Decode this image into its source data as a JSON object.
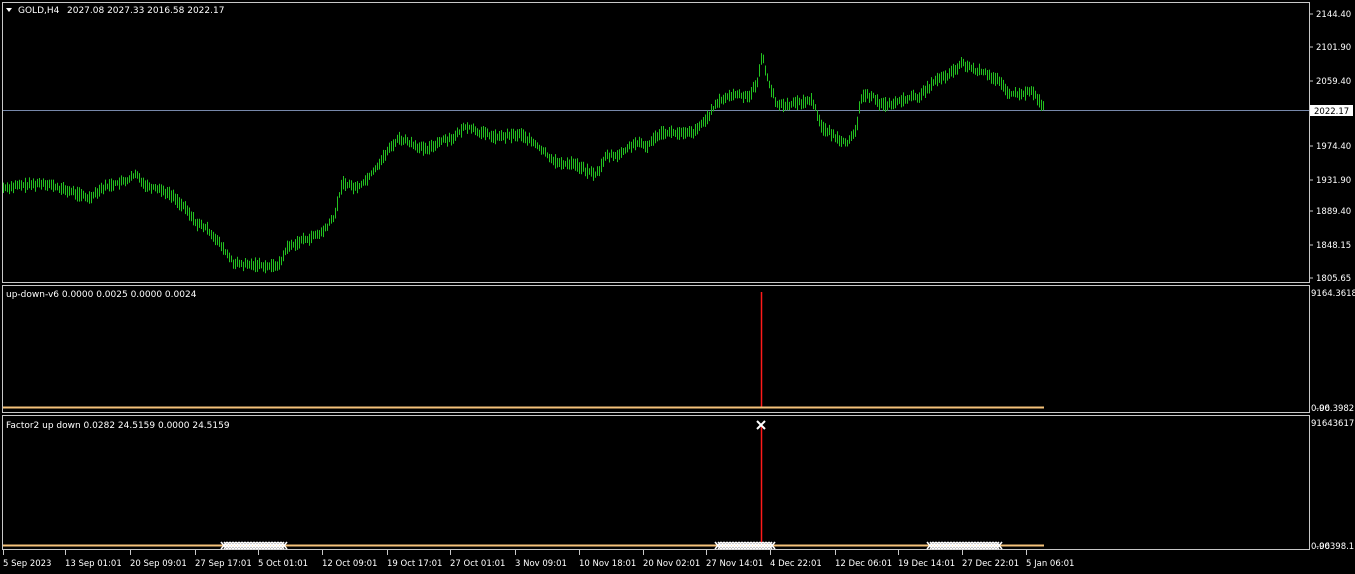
{
  "main": {
    "header_symbol": "GOLD,H4",
    "header_values": "2027.08 2027.33 2016.58 2022.17",
    "current_price_label": "2022.17",
    "current_price": 2022.17,
    "y_ticks": [
      "2144.40",
      "2101.90",
      "2059.40",
      "2022.17",
      "1974.40",
      "1931.90",
      "1889.40",
      "1848.15",
      "1805.65"
    ],
    "ylim": [
      1805.65,
      2144.4
    ],
    "bar_color": "#22c21f",
    "price_line_color": "#7788aa"
  },
  "pane1": {
    "title": "up-down-v6 0.0000 0.0025 0.0000 0.0024",
    "y_ticks": [
      "9164.3618",
      "0.00",
      "-96.3982"
    ],
    "spike_color": "#ff1a1a",
    "baseline_color": "#f5c27a"
  },
  "pane2": {
    "title": "Factor2 up down 0.0282 24.5159 0.0000 24.5159",
    "y_ticks": [
      "91643617.",
      "0.00",
      "-96398.1"
    ],
    "spike_color": "#ff1a1a",
    "baseline_color": "#f5c27a",
    "marker_color": "#ffffff"
  },
  "x_ticks": [
    "5 Sep 2023",
    "13 Sep 01:01",
    "20 Sep 09:01",
    "27 Sep 17:01",
    "5 Oct 01:01",
    "12 Oct 09:01",
    "19 Oct 17:01",
    "27 Oct 01:01",
    "3 Nov 09:01",
    "10 Nov 18:01",
    "20 Nov 02:01",
    "27 Nov 14:01",
    "4 Dec 22:01",
    "12 Dec 06:01",
    "19 Dec 14:01",
    "27 Dec 22:01",
    "5 Jan 06:01"
  ],
  "chart_data": {
    "type": "ohlc",
    "price_anchors": [
      [
        0,
        1925
      ],
      [
        20,
        1928
      ],
      [
        30,
        1929
      ],
      [
        44,
        1932
      ],
      [
        60,
        1924
      ],
      [
        72,
        1920
      ],
      [
        88,
        1912
      ],
      [
        100,
        1924
      ],
      [
        112,
        1930
      ],
      [
        124,
        1933
      ],
      [
        136,
        1942
      ],
      [
        146,
        1928
      ],
      [
        158,
        1925
      ],
      [
        172,
        1915
      ],
      [
        184,
        1900
      ],
      [
        196,
        1880
      ],
      [
        206,
        1873
      ],
      [
        214,
        1863
      ],
      [
        222,
        1848
      ],
      [
        234,
        1828
      ],
      [
        246,
        1826
      ],
      [
        258,
        1827
      ],
      [
        270,
        1824
      ],
      [
        280,
        1828
      ],
      [
        286,
        1848
      ],
      [
        300,
        1857
      ],
      [
        312,
        1862
      ],
      [
        322,
        1868
      ],
      [
        334,
        1888
      ],
      [
        342,
        1932
      ],
      [
        356,
        1925
      ],
      [
        366,
        1936
      ],
      [
        376,
        1952
      ],
      [
        386,
        1970
      ],
      [
        398,
        1989
      ],
      [
        412,
        1982
      ],
      [
        426,
        1973
      ],
      [
        440,
        1986
      ],
      [
        454,
        1990
      ],
      [
        466,
        2005
      ],
      [
        480,
        1996
      ],
      [
        496,
        1990
      ],
      [
        510,
        1992
      ],
      [
        520,
        1994
      ],
      [
        536,
        1980
      ],
      [
        548,
        1966
      ],
      [
        560,
        1955
      ],
      [
        572,
        1958
      ],
      [
        584,
        1948
      ],
      [
        596,
        1942
      ],
      [
        606,
        1966
      ],
      [
        620,
        1968
      ],
      [
        634,
        1983
      ],
      [
        646,
        1978
      ],
      [
        660,
        1997
      ],
      [
        672,
        1996
      ],
      [
        684,
        1994
      ],
      [
        696,
        1998
      ],
      [
        708,
        2018
      ],
      [
        720,
        2038
      ],
      [
        734,
        2045
      ],
      [
        748,
        2043
      ],
      [
        756,
        2057
      ],
      [
        762,
        2095
      ],
      [
        768,
        2062
      ],
      [
        776,
        2032
      ],
      [
        788,
        2032
      ],
      [
        800,
        2035
      ],
      [
        812,
        2038
      ],
      [
        822,
        2002
      ],
      [
        836,
        1990
      ],
      [
        848,
        1983
      ],
      [
        856,
        1998
      ],
      [
        860,
        2040
      ],
      [
        872,
        2045
      ],
      [
        880,
        2032
      ],
      [
        894,
        2033
      ],
      [
        906,
        2040
      ],
      [
        920,
        2043
      ],
      [
        934,
        2062
      ],
      [
        948,
        2069
      ],
      [
        962,
        2085
      ],
      [
        974,
        2076
      ],
      [
        986,
        2073
      ],
      [
        998,
        2062
      ],
      [
        1008,
        2046
      ],
      [
        1020,
        2045
      ],
      [
        1032,
        2049
      ],
      [
        1044,
        2026
      ]
    ]
  }
}
